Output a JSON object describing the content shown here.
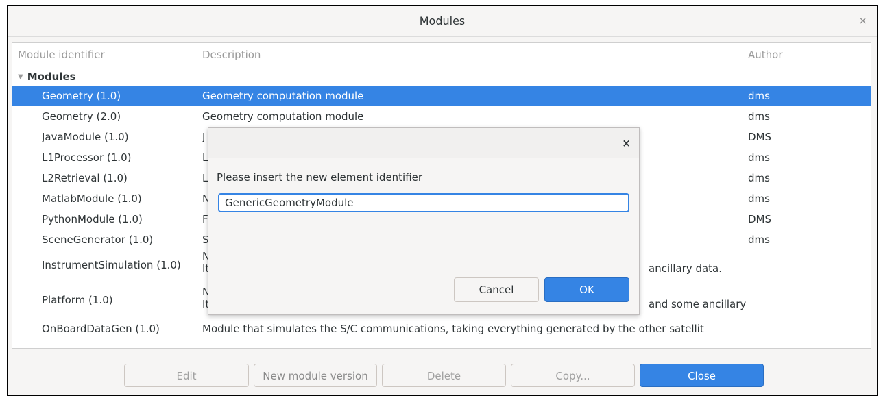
{
  "window": {
    "title": "Modules",
    "close_glyph": "×"
  },
  "table": {
    "headers": [
      "Module identifier",
      "Description",
      "Author"
    ],
    "group": "Modules",
    "rows": [
      {
        "id": "Geometry (1.0)",
        "desc": "Geometry computation module",
        "author": "dms",
        "selected": true
      },
      {
        "id": "Geometry (2.0)",
        "desc": "Geometry computation module",
        "author": "dms"
      },
      {
        "id": "JavaModule (1.0)",
        "desc": "J",
        "author": "DMS"
      },
      {
        "id": "L1Processor (1.0)",
        "desc": "L",
        "author": "dms"
      },
      {
        "id": "L2Retrieval (1.0)",
        "desc": "L",
        "author": "dms"
      },
      {
        "id": "MatlabModule (1.0)",
        "desc": "N",
        "author": "dms"
      },
      {
        "id": "PythonModule (1.0)",
        "desc": "F",
        "author": "DMS"
      },
      {
        "id": "SceneGenerator (1.0)",
        "desc": "S",
        "author": "dms"
      },
      {
        "id": "InstrumentSimulation (1.0)",
        "desc": "N",
        "desc2": "It",
        "desc_tail": "ancillary data.",
        "author": ""
      },
      {
        "id": "Platform (1.0)",
        "desc": "N",
        "desc2": "It",
        "desc_tail": "and some ancillary",
        "author": ""
      },
      {
        "id": "OnBoardDataGen (1.0)",
        "desc": "Module that simulates the S/C communications, taking everything generated by the other satellit",
        "author": ""
      }
    ]
  },
  "buttons": {
    "edit": "Edit",
    "new_version": "New module version",
    "delete": "Delete",
    "copy": "Copy...",
    "close": "Close"
  },
  "dialog": {
    "close_glyph": "×",
    "prompt": "Please insert the new element identifier",
    "value": "GenericGeometryModule",
    "cancel": "Cancel",
    "ok": "OK"
  },
  "colors": {
    "accent": "#3584e4",
    "background": "#f6f5f4"
  }
}
